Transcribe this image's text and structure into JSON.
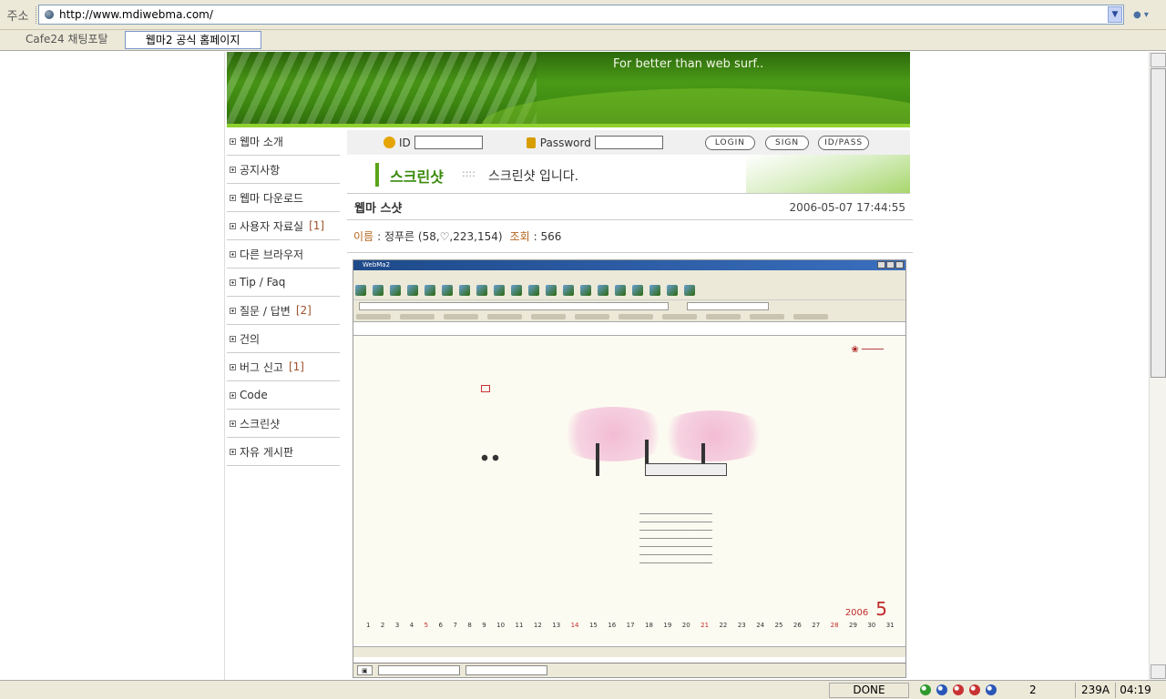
{
  "browser": {
    "addr_label": "주소",
    "url": "http://www.mdiwebma.com/",
    "tabs": [
      {
        "label": "Cafe24 채팅포탈",
        "active": false
      },
      {
        "label": "웹마2 공식 홈페이지",
        "active": true
      }
    ]
  },
  "banner": {
    "slogan": "For better than web surf.."
  },
  "menu": {
    "items": [
      {
        "label": "웹마 소개",
        "count": ""
      },
      {
        "label": "공지사항",
        "count": ""
      },
      {
        "label": "웹마 다운로드",
        "count": ""
      },
      {
        "label": "사용자 자료실",
        "count": "[1]"
      },
      {
        "label": "다른 브라우저",
        "count": ""
      },
      {
        "label": "Tip / Faq",
        "count": ""
      },
      {
        "label": "질문 / 답변",
        "count": "[2]"
      },
      {
        "label": "건의",
        "count": ""
      },
      {
        "label": "버그 신고",
        "count": "[1]"
      },
      {
        "label": "Code",
        "count": ""
      },
      {
        "label": "스크린샷",
        "count": ""
      },
      {
        "label": "자유 게시판",
        "count": ""
      }
    ]
  },
  "login": {
    "id_label": "ID",
    "password_label": "Password",
    "login_button": "LOGIN",
    "sign_button": "SIGN",
    "idpass_button": "ID/PASS"
  },
  "section": {
    "title": "스크린샷",
    "separator": "::::",
    "description": "스크린샷 입니다."
  },
  "post": {
    "title": "웹마 스샷",
    "date": "2006-05-07 17:44:55",
    "name_label": "이름",
    "name_value": ": 정푸른 (58,♡,223,154)",
    "views_label": "조회",
    "views_value": ": 566"
  },
  "screenshot": {
    "window_title": "WebMa2",
    "calendar_year": "2006",
    "calendar_month": "5",
    "days": [
      "1",
      "2",
      "3",
      "4",
      "5",
      "6",
      "7",
      "8",
      "9",
      "10",
      "11",
      "12",
      "13",
      "14",
      "15",
      "16",
      "17",
      "18",
      "19",
      "20",
      "21",
      "22",
      "23",
      "24",
      "25",
      "26",
      "27",
      "28",
      "29",
      "30",
      "31"
    ],
    "red_days": [
      "5",
      "14",
      "21",
      "28"
    ]
  },
  "status": {
    "done": "DONE",
    "count": "2",
    "memory": "239A",
    "time": "04:19",
    "icon_colors": [
      "#2e9a2e",
      "#2a56b8",
      "#c83232",
      "#c83232",
      "#2a56b8"
    ]
  }
}
